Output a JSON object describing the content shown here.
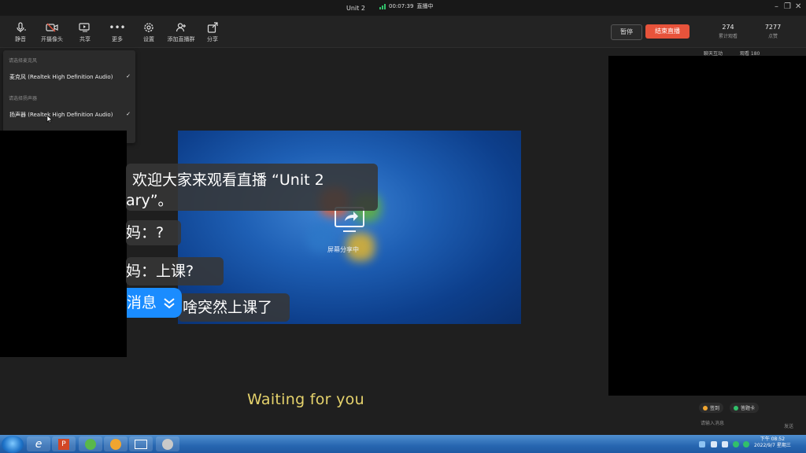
{
  "titlebar": {
    "title": "Unit 2",
    "live_time": "00:07:39",
    "live_status": "直播中"
  },
  "toolbar": {
    "items": [
      {
        "label": "静音",
        "icon": "microphone-icon"
      },
      {
        "label": "开摄像头",
        "icon": "camera-off-icon"
      },
      {
        "label": "共享",
        "icon": "screen-share-icon"
      },
      {
        "label": "更多",
        "icon": "more-icon"
      },
      {
        "label": "设置",
        "icon": "gear-icon"
      },
      {
        "label": "添加直播群",
        "icon": "add-group-icon"
      },
      {
        "label": "分享",
        "icon": "share-icon"
      }
    ],
    "pause_label": "暂停",
    "end_label": "结束直播",
    "stats": [
      {
        "value": "274",
        "label": "累计观看"
      },
      {
        "value": "7277",
        "label": "点赞"
      }
    ]
  },
  "dropdown": {
    "mic_section": "请选择麦克风",
    "mic_option": "麦克风 (Realtek High Definition Audio)",
    "speaker_section": "请选择扬声器",
    "speaker_option": "扬声器 (Realtek High Definition Audio)",
    "check": "✓"
  },
  "stage": {
    "sharing_label": "屏幕分享中"
  },
  "chat": {
    "welcome_line1": "欢迎大家来观看直播 “Unit 2",
    "welcome_line2": "ary”。",
    "msg1": "妈：?",
    "msg2": "妈：上课?",
    "msg3": "啥突然上课了",
    "new_msg_label": "消息"
  },
  "lyric": "Waiting for you",
  "sidebar": {
    "tab_chat": "聊天互动",
    "tab_viewers": "观看 180",
    "checkin_label": "签到",
    "quiz_label": "答题卡",
    "input_placeholder": "请输入消息",
    "send_label": "发送"
  },
  "taskbar": {
    "time": "下午 08:52",
    "date": "2022/9/7 星期三"
  },
  "colors": {
    "accent_end": "#e7533b",
    "new_msg_blue": "#1a8cff",
    "lyric_yellow": "#e6d36c"
  }
}
